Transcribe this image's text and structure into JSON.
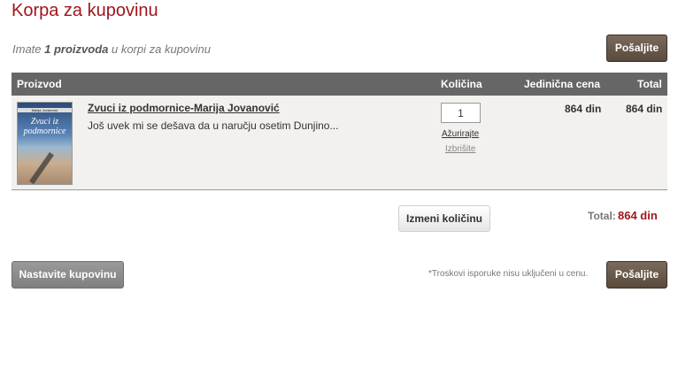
{
  "page": {
    "title": "Korpa za kupovinu"
  },
  "intro": {
    "prefix": "Imate ",
    "count": "1 proizvoda",
    "suffix": " u korpi za kupovinu"
  },
  "buttons": {
    "send_top": "Pošaljite",
    "send_bottom": "Pošaljite",
    "update_quantity": "Izmeni količinu",
    "continue_shopping": "Nastavite kupovinu"
  },
  "table": {
    "headers": {
      "product": "Proizvod",
      "quantity": "Količina",
      "unit_price": "Jedinična cena",
      "total": "Total"
    },
    "items": [
      {
        "name": "Zvuci iz podmornice-Marija Jovanović",
        "description": "Još uvek mi se dešava da u naručju osetim Dunjino...",
        "cover_author": "Marija Jovanović",
        "cover_title": "Zvuci iz podmornice",
        "quantity": "1",
        "update_link": "Ažurirajte",
        "delete_link": "Izbrišite",
        "unit_price": "864 din",
        "total": "864 din"
      }
    ]
  },
  "summary": {
    "total_label": "Total:",
    "total_value": "864 din"
  },
  "note": "*Troskovi isporuke nisu uključeni u cenu."
}
